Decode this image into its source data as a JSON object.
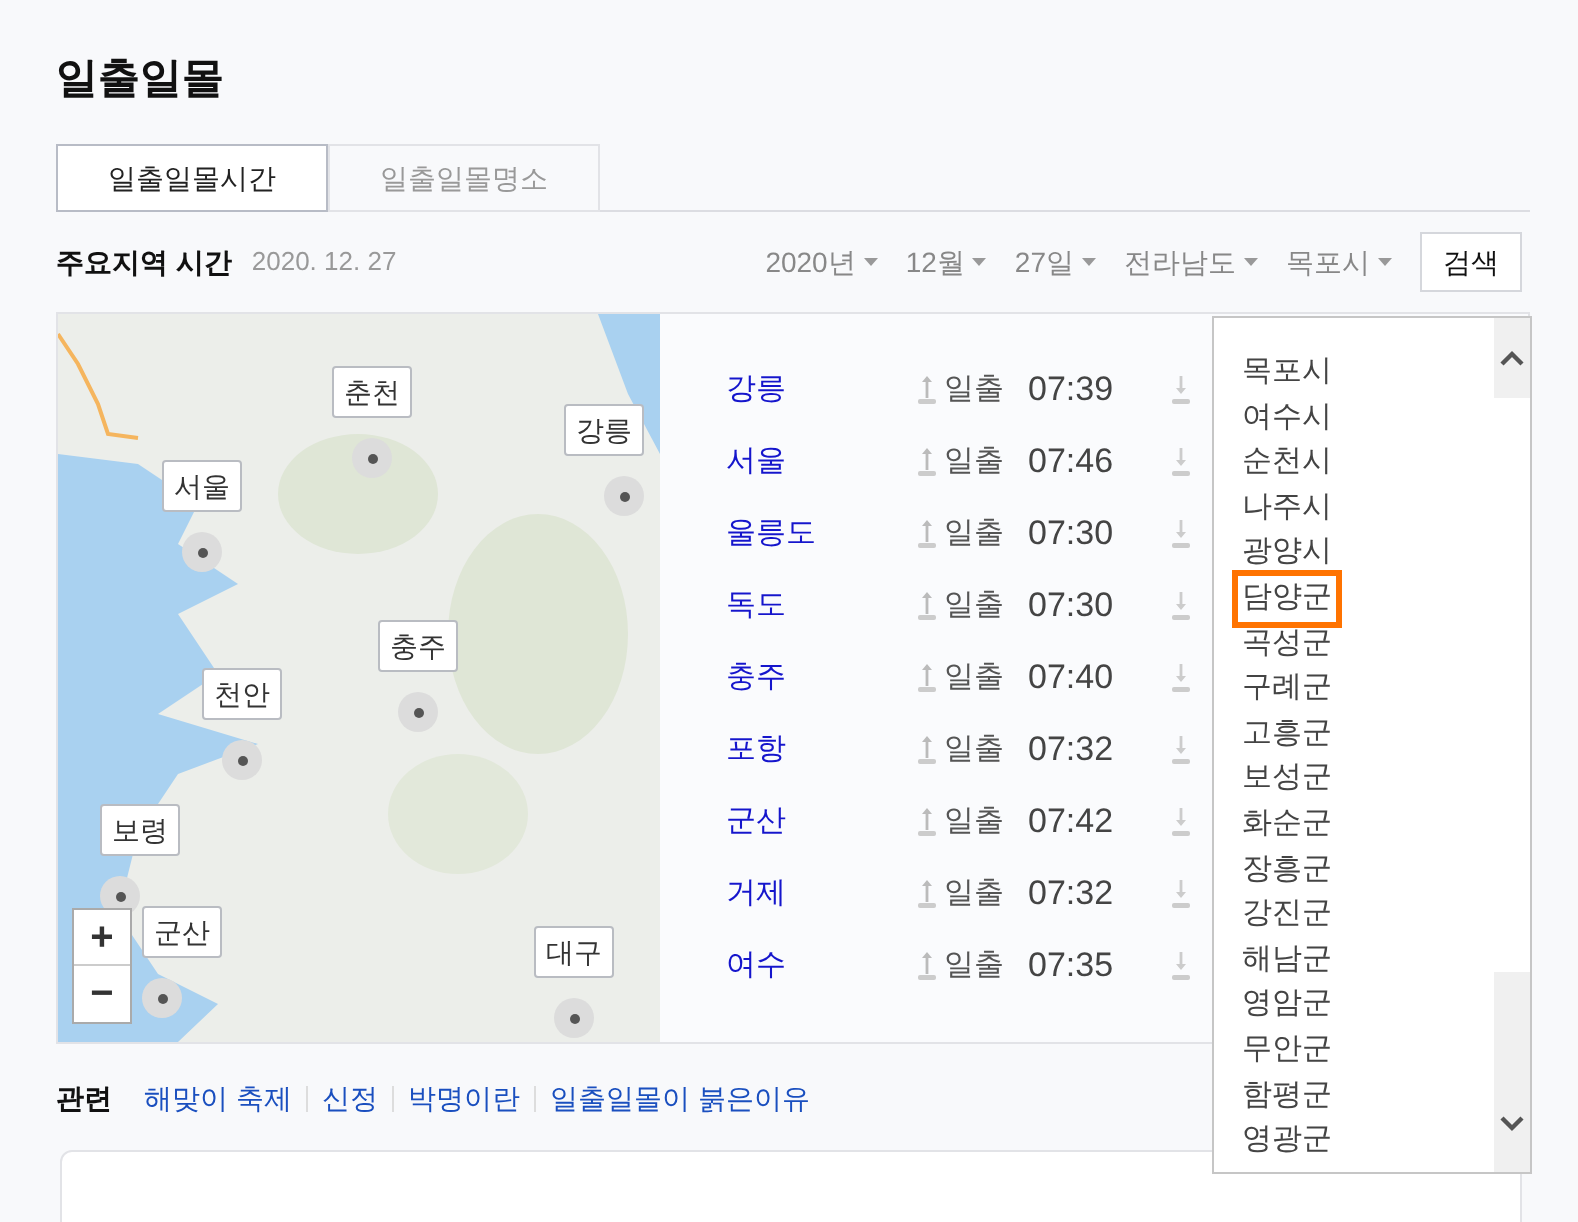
{
  "title": "일출일몰",
  "tabs": [
    {
      "label": "일출일몰시간",
      "selected": true
    },
    {
      "label": "일출일몰명소",
      "selected": false
    }
  ],
  "section": {
    "heading": "주요지역 시간",
    "date": "2020. 12. 27"
  },
  "filters": [
    "2020년",
    "12월",
    "27일",
    "전라남도",
    "목포시"
  ],
  "search_button": "검색",
  "map": {
    "labels": [
      "춘천",
      "강릉",
      "서울",
      "충주",
      "천안",
      "보령",
      "군산",
      "대구"
    ],
    "zoom_in": "+",
    "zoom_out": "−"
  },
  "rows": [
    {
      "city": "강릉",
      "label": "일출",
      "time": "07:39"
    },
    {
      "city": "서울",
      "label": "일출",
      "time": "07:46"
    },
    {
      "city": "울릉도",
      "label": "일출",
      "time": "07:30"
    },
    {
      "city": "독도",
      "label": "일출",
      "time": "07:30"
    },
    {
      "city": "충주",
      "label": "일출",
      "time": "07:40"
    },
    {
      "city": "포항",
      "label": "일출",
      "time": "07:32"
    },
    {
      "city": "군산",
      "label": "일출",
      "time": "07:42"
    },
    {
      "city": "거제",
      "label": "일출",
      "time": "07:32"
    },
    {
      "city": "여수",
      "label": "일출",
      "time": "07:35"
    }
  ],
  "dropdown": [
    {
      "label": "목포시",
      "selected": false
    },
    {
      "label": "여수시",
      "selected": false
    },
    {
      "label": "순천시",
      "selected": false
    },
    {
      "label": "나주시",
      "selected": false
    },
    {
      "label": "광양시",
      "selected": false
    },
    {
      "label": "담양군",
      "selected": true
    },
    {
      "label": "곡성군",
      "selected": false
    },
    {
      "label": "구례군",
      "selected": false
    },
    {
      "label": "고흥군",
      "selected": false
    },
    {
      "label": "보성군",
      "selected": false
    },
    {
      "label": "화순군",
      "selected": false
    },
    {
      "label": "장흥군",
      "selected": false
    },
    {
      "label": "강진군",
      "selected": false
    },
    {
      "label": "해남군",
      "selected": false
    },
    {
      "label": "영암군",
      "selected": false
    },
    {
      "label": "무안군",
      "selected": false
    },
    {
      "label": "함평군",
      "selected": false
    },
    {
      "label": "영광군",
      "selected": false
    }
  ],
  "related": {
    "label": "관련",
    "links": [
      "해맞이 축제",
      "신정",
      "박명이란",
      "일출일몰이 붉은이유"
    ]
  }
}
